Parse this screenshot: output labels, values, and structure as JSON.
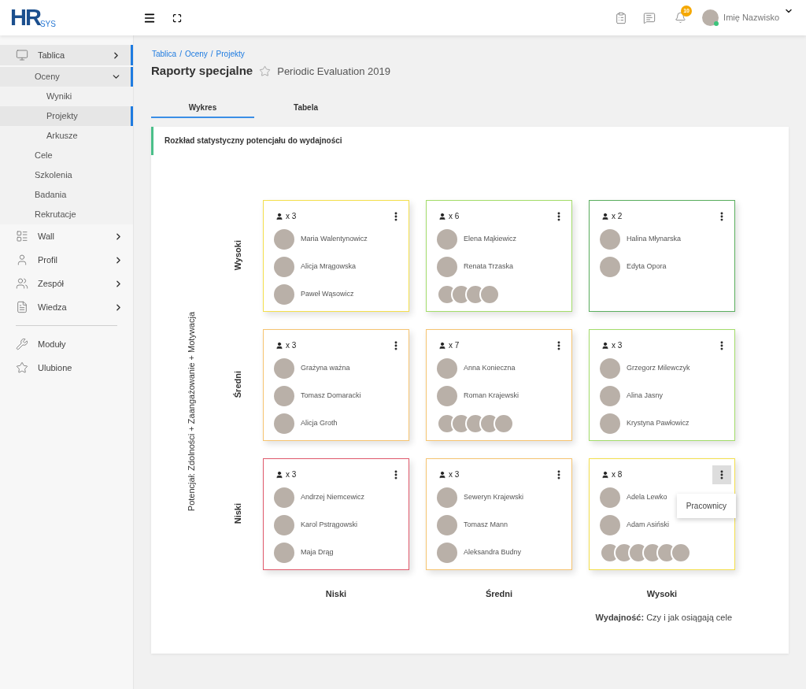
{
  "header": {
    "logo": {
      "main": "HR",
      "sub": "SYS"
    },
    "notifications": {
      "badge": "10"
    },
    "user": {
      "name": "Imię Nazwisko",
      "online": true
    }
  },
  "sidebar": {
    "items": [
      {
        "label": "Tablica",
        "kind": "menu",
        "selected": true,
        "children": [
          {
            "label": "Oceny",
            "selected": true,
            "expanded": true,
            "children": [
              {
                "label": "Wyniki",
                "selected": false
              },
              {
                "label": "Projekty",
                "selected": true
              },
              {
                "label": "Arkusze",
                "selected": false
              }
            ]
          },
          {
            "label": "Cele",
            "selected": false
          },
          {
            "label": "Szkolenia",
            "selected": false
          },
          {
            "label": "Badania",
            "selected": false
          },
          {
            "label": "Rekrutacje",
            "selected": false
          }
        ]
      },
      {
        "label": "Wall",
        "kind": "menu",
        "selected": false
      },
      {
        "label": "Profil",
        "kind": "menu",
        "selected": false
      },
      {
        "label": "Zespół",
        "kind": "menu",
        "selected": false
      },
      {
        "label": "Wiedza",
        "kind": "menu",
        "selected": false
      },
      {
        "kind": "divider"
      },
      {
        "label": "Moduły",
        "kind": "link",
        "selected": false
      },
      {
        "label": "Ulubione",
        "kind": "link",
        "selected": false
      }
    ]
  },
  "breadcrumb": {
    "items": [
      "Tablica",
      "Oceny",
      "Projekty"
    ],
    "separator": "/"
  },
  "page": {
    "title": "Raporty specjalne",
    "favorite": false,
    "subtitle": "Periodic Evaluation 2019"
  },
  "tabs": [
    {
      "label": "Wykres",
      "selected": true
    },
    {
      "label": "Tabela",
      "selected": false
    }
  ],
  "panel": {
    "title": "Rozkład statystyczny potencjału do wydajności",
    "y_axis": "Potencjał: Zdolności + Zaangażowanie + Motywacja",
    "row_labels": [
      "Wysoki",
      "Średni",
      "Niski"
    ],
    "column_labels": [
      "Niski",
      "Średni",
      "Wysoki"
    ],
    "x_axis": "**Wydajność:** Czy i jak osiągają cele",
    "cells": [
      {
        "color": "#f3df4d",
        "count": "x 3",
        "menu_open": false,
        "people": [
          "Maria Walentynowicz",
          "Alicja Mrągowska",
          "Paweł Wąsowicz"
        ]
      },
      {
        "color": "#a3dc6a",
        "count": "x 6",
        "menu_open": false,
        "people": [
          "Elena Mąkiewicz",
          "Renata Trzaska"
        ],
        "more": [
          {
            "kind": "photo"
          },
          {
            "kind": "photo"
          },
          {
            "kind": "photo"
          },
          {
            "kind": "photo"
          }
        ]
      },
      {
        "color": "#5aae5e",
        "count": "x 2",
        "menu_open": false,
        "people": [
          "Halina Młynarska",
          "Edyta Opora"
        ]
      },
      {
        "color": "#f6c471",
        "count": "x 3",
        "menu_open": false,
        "people": [
          "Grażyna ważna",
          "Tomasz Domaracki",
          "Alicja Groth"
        ]
      },
      {
        "color": "#f6c471",
        "count": "x 7",
        "menu_open": false,
        "people": [
          "Anna Konieczna",
          "Roman Krajewski"
        ],
        "more": [
          {
            "kind": "photo"
          },
          {
            "kind": "photo"
          },
          {
            "kind": "photo"
          },
          {
            "kind": "photo"
          },
          {
            "kind": "photo"
          }
        ]
      },
      {
        "color": "#a3dc6a",
        "count": "x 3",
        "menu_open": false,
        "people": [
          "Grzegorz Milewczyk",
          "Alina Jasny",
          "Krystyna Pawłowicz"
        ]
      },
      {
        "color": "#e05a6c",
        "count": "x 3",
        "menu_open": false,
        "people": [
          "Andrzej Niemcewicz",
          "Karol Pstrągowski",
          "Maja Drąg"
        ]
      },
      {
        "color": "#f6c471",
        "count": "x 3",
        "menu_open": false,
        "people": [
          "Seweryn Krajewski",
          "Tomasz Mann",
          "Aleksandra Budny"
        ]
      },
      {
        "color": "#f3df4d",
        "count": "x 8",
        "menu_open": true,
        "menu": [
          "Pracownicy"
        ],
        "people": [
          "Adela Lewko",
          "Adam Asiński"
        ],
        "more": [
          {
            "kind": "photo"
          },
          {
            "kind": "photo"
          },
          {
            "kind": "photo"
          },
          {
            "kind": "photo"
          },
          {
            "kind": "photo"
          },
          {
            "kind": "photo"
          }
        ]
      }
    ]
  }
}
